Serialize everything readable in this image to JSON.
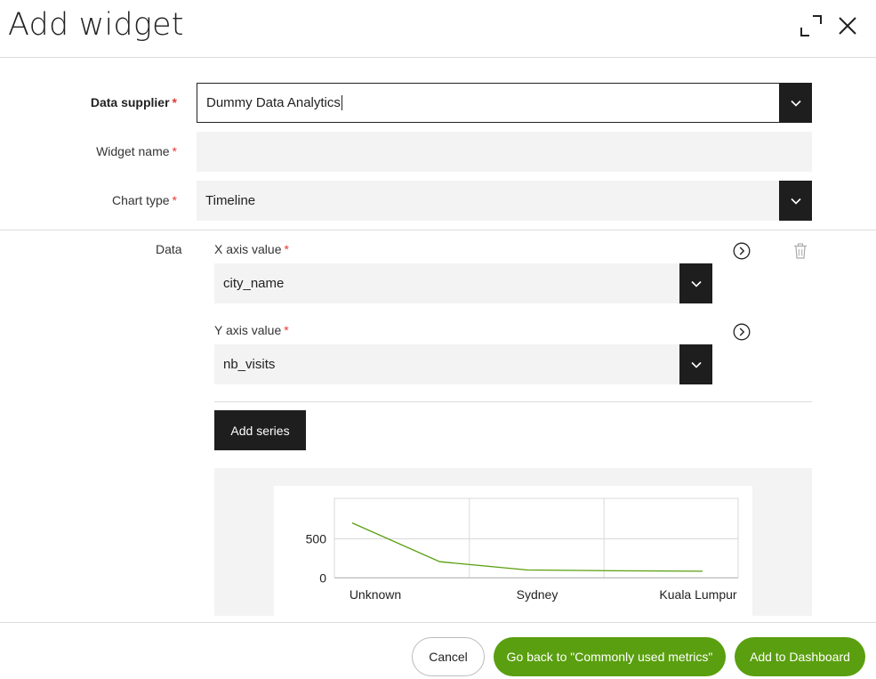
{
  "dialog": {
    "title": "Add widget"
  },
  "form": {
    "data_supplier": {
      "label": "Data supplier",
      "required": "*",
      "value": "Dummy Data Analytics"
    },
    "widget_name": {
      "label": "Widget name",
      "required": "*",
      "value": ""
    },
    "chart_type": {
      "label": "Chart type",
      "required": "*",
      "value": "Timeline"
    }
  },
  "data_section": {
    "label": "Data",
    "x_axis": {
      "label": "X axis value",
      "required": "*",
      "value": "city_name"
    },
    "y_axis": {
      "label": "Y axis value",
      "required": "*",
      "value": "nb_visits"
    },
    "add_series_label": "Add series"
  },
  "chart_data": {
    "type": "line",
    "categories": [
      "Unknown",
      "Sydney",
      "Kuala Lumpur"
    ],
    "series": [
      {
        "x": [
          0,
          1,
          2,
          3,
          4
        ],
        "values": [
          690,
          200,
          95,
          85,
          80
        ],
        "color": "#5a9f0f"
      }
    ],
    "y_ticks": [
      "0",
      "500"
    ],
    "ylim": [
      0,
      1000
    ],
    "grid": true
  },
  "footer": {
    "cancel_label": "Cancel",
    "go_back_label": "Go back to \"Commonly used metrics\"",
    "add_label": "Add to Dashboard"
  },
  "colors": {
    "accent": "#5a9f0f",
    "required": "#e53935",
    "dark": "#1e1e1e"
  }
}
